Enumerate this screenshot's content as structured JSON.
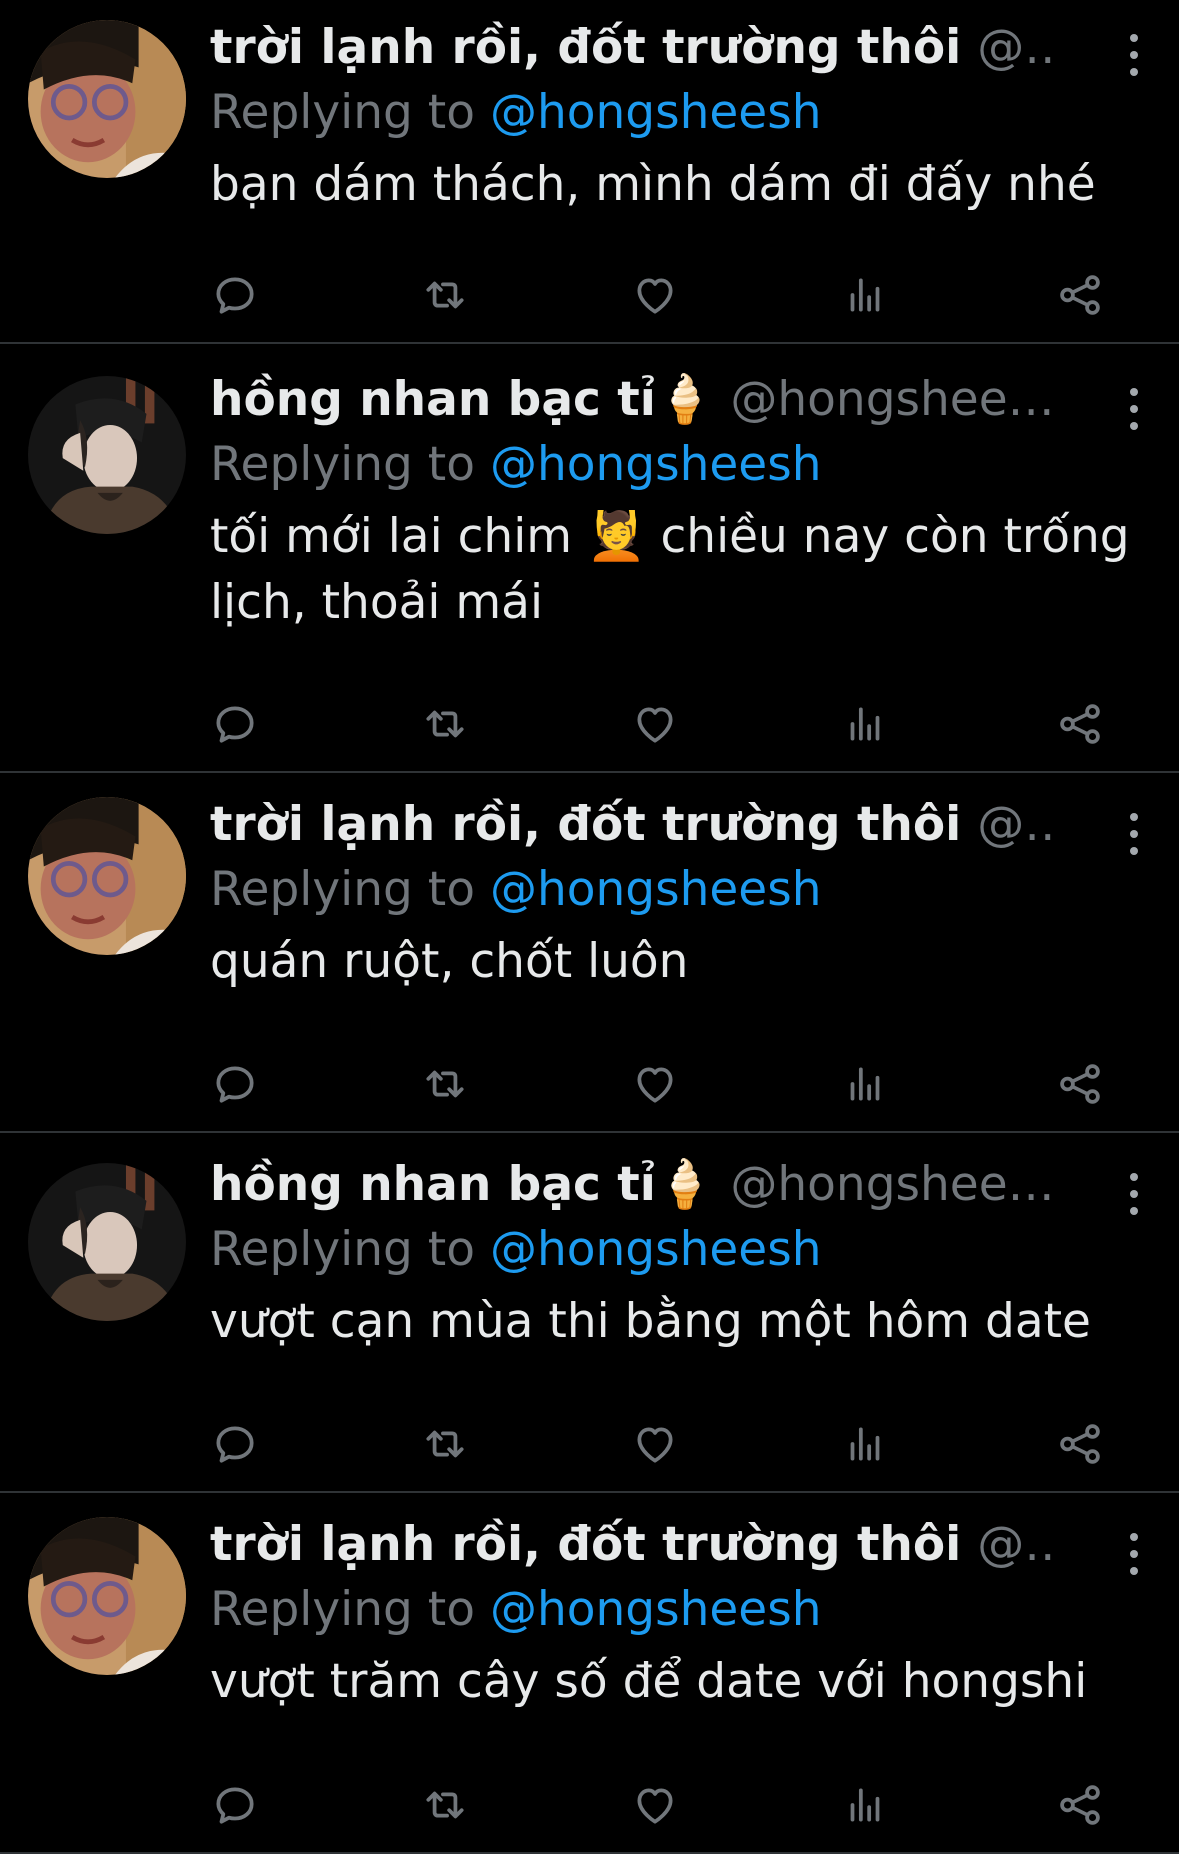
{
  "tweets": [
    {
      "display_name": "trời lạnh rồi, đốt trường thôi",
      "handle": "@n...",
      "reply_prefix": "Replying to",
      "reply_handle": "@hongsheesh",
      "text": "bạn dám thách, mình dám đi đấy nhé",
      "avatar": "avatar-user-1"
    },
    {
      "display_name": "hồng nhan bạc tỉ🍦",
      "handle": "@hongshees...",
      "reply_prefix": "Replying to",
      "reply_handle": "@hongsheesh",
      "text": "tối mới lai chim 💆 chiều nay còn trống lịch, thoải mái",
      "avatar": "avatar-user-2"
    },
    {
      "display_name": "trời lạnh rồi, đốt trường thôi",
      "handle": "@n...",
      "reply_prefix": "Replying to",
      "reply_handle": "@hongsheesh",
      "text": "quán ruột, chốt luôn",
      "avatar": "avatar-user-1"
    },
    {
      "display_name": "hồng nhan bạc tỉ🍦",
      "handle": "@hongshees...",
      "reply_prefix": "Replying to",
      "reply_handle": "@hongsheesh",
      "text": "vượt cạn mùa thi bằng một hôm date",
      "avatar": "avatar-user-2"
    },
    {
      "display_name": "trời lạnh rồi, đốt trường thôi",
      "handle": "@n...",
      "reply_prefix": "Replying to",
      "reply_handle": "@hongsheesh",
      "text": "vượt trăm cây số để date với hongshi",
      "avatar": "avatar-user-1"
    }
  ],
  "actions": [
    "reply-icon",
    "retweet-icon",
    "like-icon",
    "views-icon",
    "share-icon"
  ],
  "colors": {
    "background": "#000000",
    "divider": "#2f3336",
    "primary_text": "#e7e9ea",
    "secondary_text": "#71767b",
    "link": "#1d9bf0",
    "icon": "#71767b"
  }
}
